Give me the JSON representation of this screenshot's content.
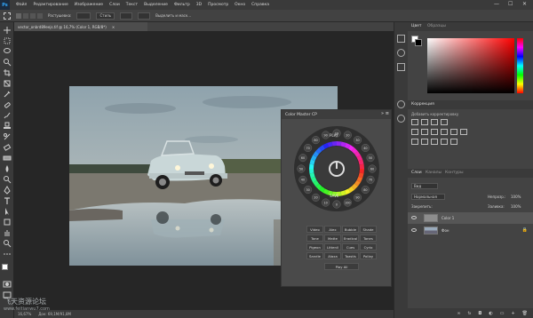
{
  "menubar": {
    "logo": "Ps",
    "items": [
      "Файл",
      "Редактирование",
      "Изображение",
      "Слои",
      "Текст",
      "Выделение",
      "Фильтр",
      "3D",
      "Просмотр",
      "Окно",
      "Справка"
    ],
    "minimize": "—",
    "maximize": "☐",
    "close": "✕"
  },
  "optionsbar": {
    "feather_label": "Растушевка:",
    "style_value": "Стиль",
    "select_mask": "Выделить и маск..."
  },
  "document": {
    "tab_title": "vector_onbrd89eejs.tif @ 16,7% (Color 1, RGB/8*)",
    "tab_close": "×"
  },
  "statusbar": {
    "zoom": "16,67%",
    "doc_info": "Док: 69,1M/91,8M"
  },
  "color_master": {
    "title": "Color Master CP",
    "center_labels": {
      "top": "PLAY",
      "bottom": "SAVE"
    },
    "buttons": [
      [
        "Video",
        "Alex",
        "Bubble",
        "Shade"
      ],
      [
        "Tone",
        "Matte",
        "Eradical",
        "Tones"
      ],
      [
        "Pigeon",
        "Littenil",
        "Cues",
        "Cyrio"
      ],
      [
        "Sandie",
        "Alaxa",
        "Toastis",
        "Pollay"
      ]
    ],
    "play_all": "Play All",
    "wheel_numbers": [
      "10",
      "20",
      "30",
      "40",
      "50",
      "60",
      "70",
      "80",
      "90",
      "100",
      "0",
      "10",
      "20",
      "30",
      "40",
      "50",
      "60",
      "70",
      "80",
      "90"
    ]
  },
  "right_panel": {
    "color_tabs": [
      "Цвет",
      "Образцы"
    ],
    "adjustments_tab": "Коррекция",
    "adjustments_label": "Добавить корректировку",
    "layers_tabs": [
      "Слои",
      "Каналы",
      "Контуры"
    ],
    "layers_kind": "Вид",
    "blend_mode": "Нормальная",
    "opacity_label": "Непрозр.:",
    "opacity_value": "100%",
    "lock_label": "Закрепить:",
    "fill_label": "Заливка:",
    "fill_value": "100%",
    "layers": [
      {
        "name": "Color 1"
      },
      {
        "name": "Фон"
      }
    ]
  },
  "watermark": {
    "line1": "飞天资源论坛",
    "line2": "www.feitianwu7.com"
  },
  "colors": {
    "accent": "#31a8ff",
    "picker_red": "#ff0000"
  }
}
